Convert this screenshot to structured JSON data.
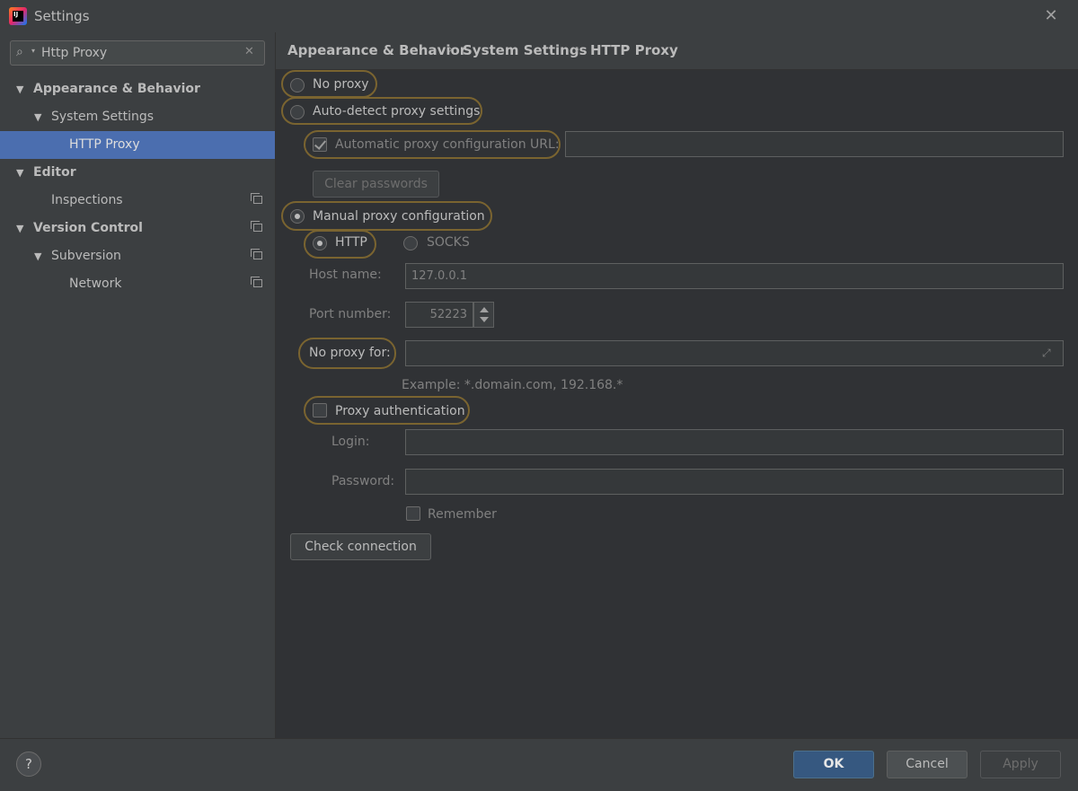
{
  "window": {
    "title": "Settings"
  },
  "search": {
    "value": "Http Proxy",
    "search_glyph": "⌕",
    "caret_glyph": "▾",
    "clear_glyph": "✕"
  },
  "tree": [
    {
      "label": "Appearance & Behavior"
    },
    {
      "label": "System Settings"
    },
    {
      "label": "HTTP Proxy"
    },
    {
      "label": "Editor"
    },
    {
      "label": "Inspections"
    },
    {
      "label": "Version Control"
    },
    {
      "label": "Subversion"
    },
    {
      "label": "Network"
    }
  ],
  "breadcrumb": [
    "Appearance & Behavior",
    "System Settings",
    "HTTP Proxy"
  ],
  "breadcrumb_sep": "›",
  "proxy": {
    "no_proxy": "No proxy",
    "auto_detect": "Auto-detect proxy settings",
    "auto_config_url": "Automatic proxy configuration URL:",
    "clear_passwords": "Clear passwords",
    "manual": "Manual proxy configuration",
    "http": "HTTP",
    "socks": "SOCKS",
    "host_label": "Host name:",
    "host_value": "127.0.0.1",
    "port_label": "Port number:",
    "port_value": "52223",
    "no_proxy_for": "No proxy for:",
    "example": "Example: *.domain.com, 192.168.*",
    "proxy_auth": "Proxy authentication",
    "login": "Login:",
    "password": "Password:",
    "remember": "Remember",
    "check_connection": "Check connection",
    "selected_mode": "Manual proxy configuration",
    "selected_type": "HTTP",
    "auto_config_url_checked": true,
    "proxy_auth_checked": false,
    "remember_checked": false
  },
  "footer": {
    "help": "?",
    "ok": "OK",
    "cancel": "Cancel",
    "apply": "Apply"
  },
  "icons": {
    "app": "intellij-app-icon",
    "close": "✕",
    "expand": "⤢"
  },
  "colors": {
    "accent": "#4b6eaf",
    "ok_button": "#365880",
    "highlight_outline": "#7a6430"
  }
}
